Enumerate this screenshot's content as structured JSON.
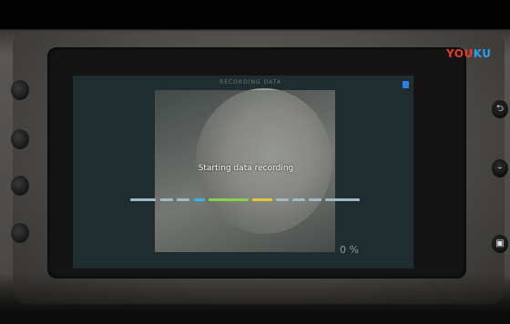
{
  "overlay": {
    "logo_part1": "YOU",
    "logo_part2": "KU"
  },
  "screen": {
    "top_label": "RECORDING DATA",
    "status_text": "Starting data recording",
    "percent": "0 %",
    "progress_fraction": 0.0
  },
  "colors": {
    "accent_blue": "#2a7fe0",
    "progress_cyan": "#35b6e6",
    "progress_green": "#8bd04a",
    "progress_yellow": "#e2c63a",
    "progress_track": "#9fbac4"
  },
  "icons": {
    "save": "save-icon",
    "side_buttons": [
      "circle-button",
      "circle-button",
      "circle-button",
      "circle-button"
    ],
    "right_buttons": [
      "back-icon",
      "minus-icon",
      "menu-icon"
    ]
  }
}
